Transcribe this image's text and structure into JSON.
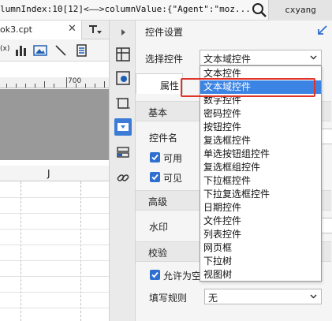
{
  "topbar": {
    "log_text": "lumnIndex:10[12]<——>columnValue:{\"Agent\":\"moz...",
    "user": "cxyang"
  },
  "editor": {
    "tab_label": "ok3.cpt",
    "toolbar_x": "(x)",
    "ruler_number": "700",
    "column_header": "J"
  },
  "panel": {
    "title": "控件设置",
    "select_label": "选择控件",
    "select_value": "文本域控件",
    "tab_attributes": "属性",
    "section_basic": "基本",
    "widget_name_label": "控件名",
    "available_label": "可用",
    "visible_label": "可见",
    "section_advanced": "高级",
    "watermark_label": "水印",
    "section_validate": "校验",
    "allow_empty_label": "允许为空",
    "fill_rule_label": "填写规则",
    "fill_rule_value": "无"
  },
  "dropdown": {
    "options": [
      "文本控件",
      "文本域控件",
      "数字控件",
      "密码控件",
      "按钮控件",
      "复选框控件",
      "单选按钮组控件",
      "复选框组控件",
      "下拉框控件",
      "下拉复选框控件",
      "日期控件",
      "文件控件",
      "列表控件",
      "网页框",
      "下拉树",
      "视图树"
    ],
    "selected": "文本域控件"
  },
  "colors": {
    "accent": "#3c84e4",
    "highlight_box": "#e0342b",
    "checkbox": "#2f6fcf"
  }
}
